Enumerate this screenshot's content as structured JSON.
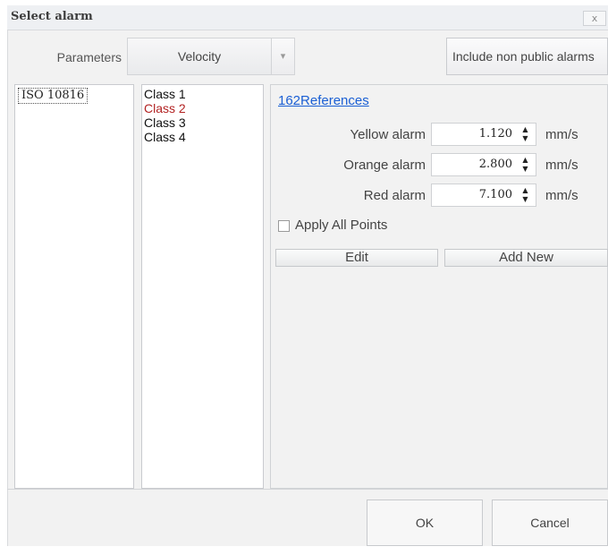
{
  "window": {
    "title": "Select alarm",
    "close_glyph": "x"
  },
  "toolbar": {
    "parameters_label": "Parameters",
    "parameter_value": "Velocity",
    "dropdown_glyph": "▾",
    "non_public_label": "Include non public alarms"
  },
  "standards": [
    {
      "label": "ISO 10816",
      "selected": true
    }
  ],
  "classes": [
    {
      "label": "Class 1",
      "color": "#111111"
    },
    {
      "label": "Class 2",
      "color": "#b22222"
    },
    {
      "label": "Class 3",
      "color": "#111111"
    },
    {
      "label": "Class 4",
      "color": "#111111"
    }
  ],
  "detail": {
    "references_link": "162References",
    "alarms": [
      {
        "label": "Yellow alarm",
        "value": "1.120",
        "unit": "mm/s"
      },
      {
        "label": "Orange alarm",
        "value": "2.800",
        "unit": "mm/s"
      },
      {
        "label": "Red alarm",
        "value": "7.100",
        "unit": "mm/s"
      }
    ],
    "apply_all_label": "Apply All Points",
    "apply_all_checked": false,
    "edit_label": "Edit",
    "add_new_label": "Add New"
  },
  "footer": {
    "ok_label": "OK",
    "cancel_label": "Cancel"
  },
  "colors": {
    "link": "#1a5fd4",
    "highlight_class": "#b22222"
  }
}
